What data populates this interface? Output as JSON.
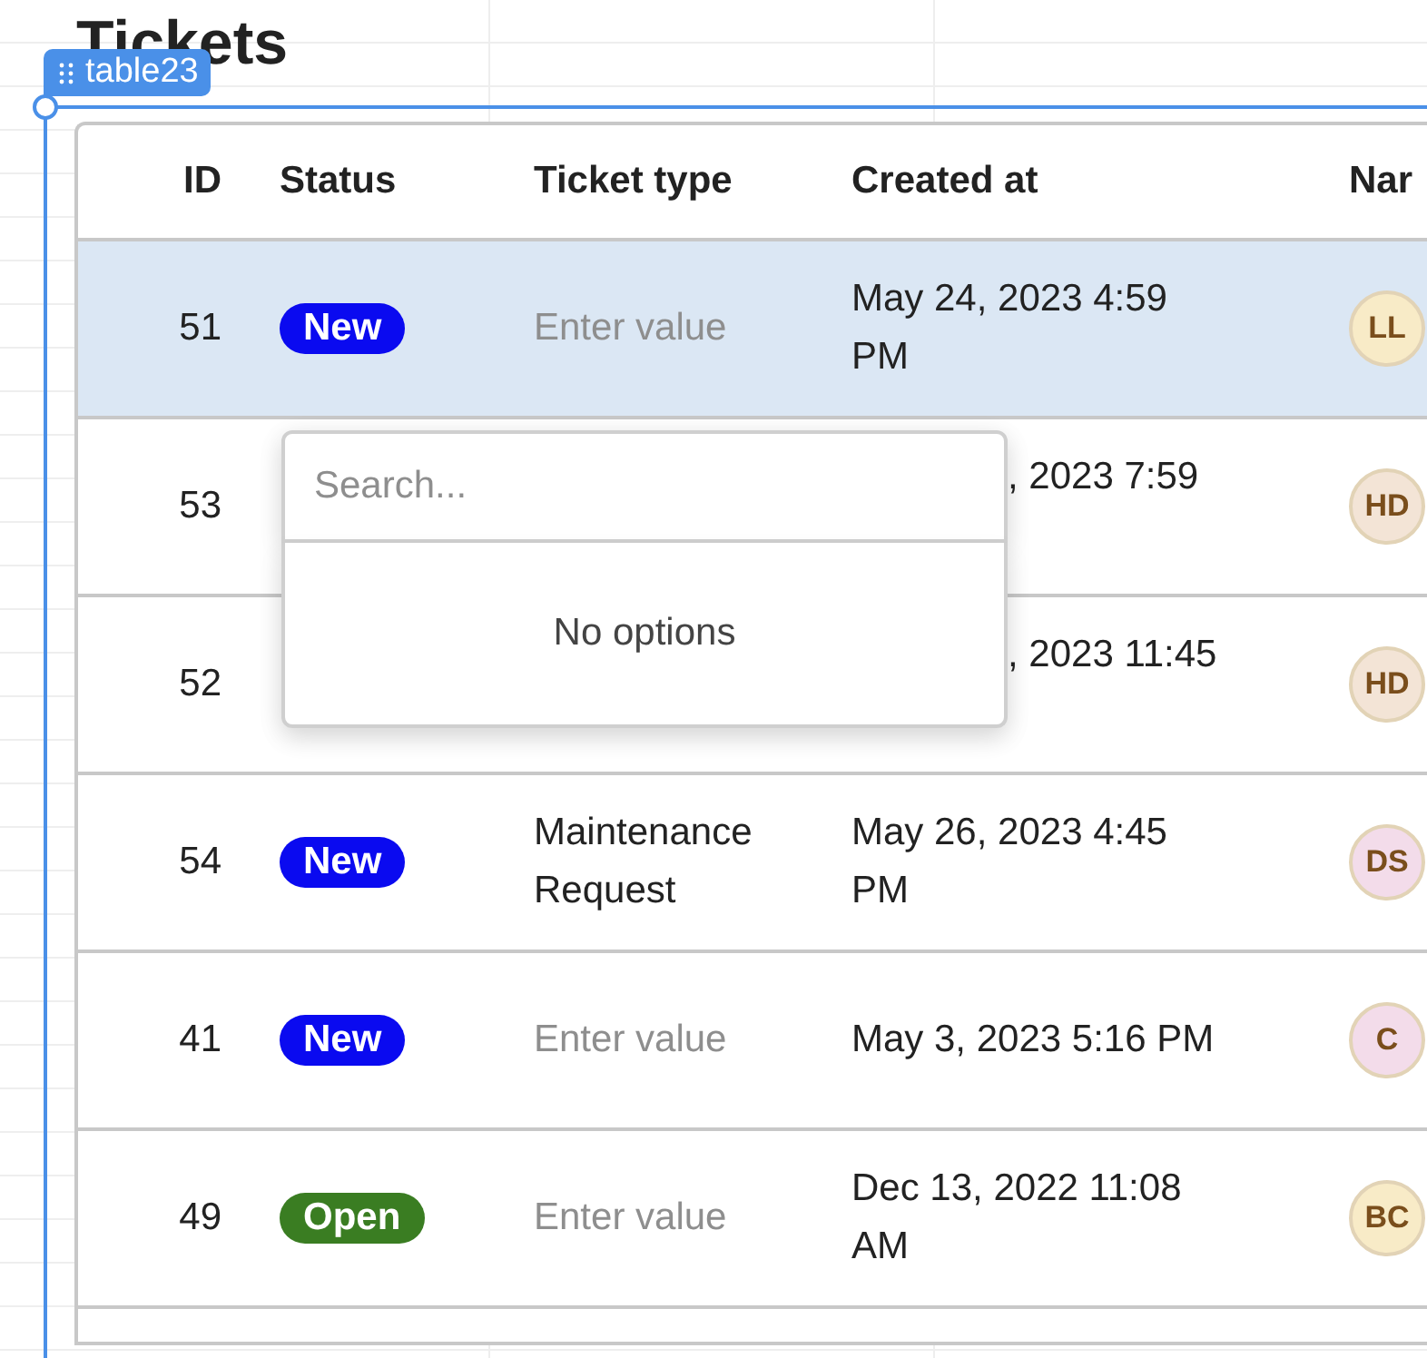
{
  "page": {
    "title": "Tickets"
  },
  "component_badge": {
    "label": "table23"
  },
  "table": {
    "columns": [
      "ID",
      "Status",
      "Ticket type",
      "Created at",
      "Nar"
    ],
    "rows": [
      {
        "id": "51",
        "selected": true,
        "status": {
          "label": "New",
          "color": "#0a0af0"
        },
        "ticket_type": {
          "placeholder": "Enter value"
        },
        "created_at": "May 24, 2023 4:59 PM",
        "avatar": {
          "initials": "LL",
          "color": "#f8ebc7"
        }
      },
      {
        "id": "53",
        "selected": false,
        "created_at": ", 2023 7:59",
        "avatar": {
          "initials": "HD",
          "color": "#f3e4d6"
        }
      },
      {
        "id": "52",
        "selected": false,
        "created_at": ", 2023 11:45",
        "avatar": {
          "initials": "HD",
          "color": "#f3e4d6"
        }
      },
      {
        "id": "54",
        "selected": false,
        "status": {
          "label": "New",
          "color": "#0a0af0"
        },
        "ticket_type": {
          "value": "Maintenance Request"
        },
        "created_at": "May 26, 2023 4:45 PM",
        "avatar": {
          "initials": "DS",
          "color": "#f3dcea"
        }
      },
      {
        "id": "41",
        "selected": false,
        "status": {
          "label": "New",
          "color": "#0a0af0"
        },
        "ticket_type": {
          "placeholder": "Enter value"
        },
        "created_at": "May 3, 2023 5:16 PM",
        "avatar": {
          "initials": "C",
          "color": "#f3dcea"
        }
      },
      {
        "id": "49",
        "selected": false,
        "status": {
          "label": "Open",
          "color": "#3a7d22"
        },
        "ticket_type": {
          "placeholder": "Enter value"
        },
        "created_at": "Dec 13, 2022 11:08 AM",
        "avatar": {
          "initials": "BC",
          "color": "#f8ebc7"
        }
      }
    ]
  },
  "dropdown": {
    "search": {
      "placeholder": "Search..."
    },
    "empty_message": "No options"
  }
}
